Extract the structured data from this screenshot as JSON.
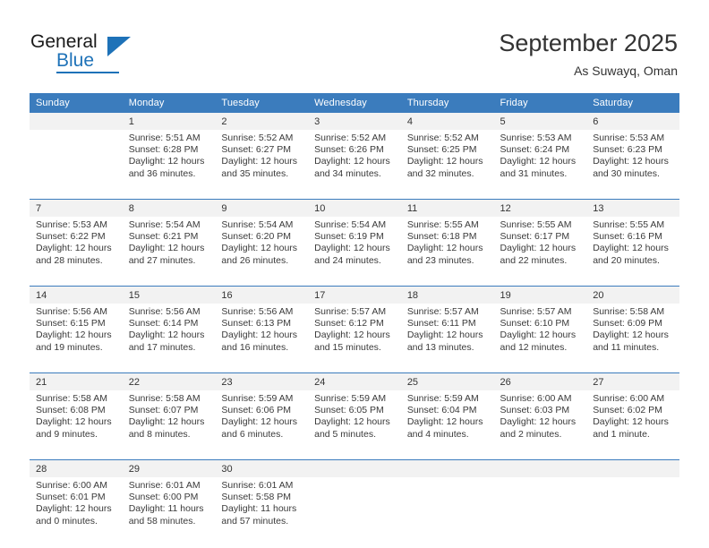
{
  "brand": {
    "name_part1": "General",
    "name_part2": "Blue",
    "accent_color": "#1e72b8"
  },
  "header": {
    "title": "September 2025",
    "subtitle": "As Suwayq, Oman"
  },
  "theme": {
    "header_row_color": "#3b7cbd",
    "day_band_color": "#f2f2f2",
    "text_color": "#333333"
  },
  "weekdays": [
    "Sunday",
    "Monday",
    "Tuesday",
    "Wednesday",
    "Thursday",
    "Friday",
    "Saturday"
  ],
  "weeks": [
    [
      {
        "day": ""
      },
      {
        "day": "1",
        "sunrise": "Sunrise: 5:51 AM",
        "sunset": "Sunset: 6:28 PM",
        "daylight1": "Daylight: 12 hours",
        "daylight2": "and 36 minutes."
      },
      {
        "day": "2",
        "sunrise": "Sunrise: 5:52 AM",
        "sunset": "Sunset: 6:27 PM",
        "daylight1": "Daylight: 12 hours",
        "daylight2": "and 35 minutes."
      },
      {
        "day": "3",
        "sunrise": "Sunrise: 5:52 AM",
        "sunset": "Sunset: 6:26 PM",
        "daylight1": "Daylight: 12 hours",
        "daylight2": "and 34 minutes."
      },
      {
        "day": "4",
        "sunrise": "Sunrise: 5:52 AM",
        "sunset": "Sunset: 6:25 PM",
        "daylight1": "Daylight: 12 hours",
        "daylight2": "and 32 minutes."
      },
      {
        "day": "5",
        "sunrise": "Sunrise: 5:53 AM",
        "sunset": "Sunset: 6:24 PM",
        "daylight1": "Daylight: 12 hours",
        "daylight2": "and 31 minutes."
      },
      {
        "day": "6",
        "sunrise": "Sunrise: 5:53 AM",
        "sunset": "Sunset: 6:23 PM",
        "daylight1": "Daylight: 12 hours",
        "daylight2": "and 30 minutes."
      }
    ],
    [
      {
        "day": "7",
        "sunrise": "Sunrise: 5:53 AM",
        "sunset": "Sunset: 6:22 PM",
        "daylight1": "Daylight: 12 hours",
        "daylight2": "and 28 minutes."
      },
      {
        "day": "8",
        "sunrise": "Sunrise: 5:54 AM",
        "sunset": "Sunset: 6:21 PM",
        "daylight1": "Daylight: 12 hours",
        "daylight2": "and 27 minutes."
      },
      {
        "day": "9",
        "sunrise": "Sunrise: 5:54 AM",
        "sunset": "Sunset: 6:20 PM",
        "daylight1": "Daylight: 12 hours",
        "daylight2": "and 26 minutes."
      },
      {
        "day": "10",
        "sunrise": "Sunrise: 5:54 AM",
        "sunset": "Sunset: 6:19 PM",
        "daylight1": "Daylight: 12 hours",
        "daylight2": "and 24 minutes."
      },
      {
        "day": "11",
        "sunrise": "Sunrise: 5:55 AM",
        "sunset": "Sunset: 6:18 PM",
        "daylight1": "Daylight: 12 hours",
        "daylight2": "and 23 minutes."
      },
      {
        "day": "12",
        "sunrise": "Sunrise: 5:55 AM",
        "sunset": "Sunset: 6:17 PM",
        "daylight1": "Daylight: 12 hours",
        "daylight2": "and 22 minutes."
      },
      {
        "day": "13",
        "sunrise": "Sunrise: 5:55 AM",
        "sunset": "Sunset: 6:16 PM",
        "daylight1": "Daylight: 12 hours",
        "daylight2": "and 20 minutes."
      }
    ],
    [
      {
        "day": "14",
        "sunrise": "Sunrise: 5:56 AM",
        "sunset": "Sunset: 6:15 PM",
        "daylight1": "Daylight: 12 hours",
        "daylight2": "and 19 minutes."
      },
      {
        "day": "15",
        "sunrise": "Sunrise: 5:56 AM",
        "sunset": "Sunset: 6:14 PM",
        "daylight1": "Daylight: 12 hours",
        "daylight2": "and 17 minutes."
      },
      {
        "day": "16",
        "sunrise": "Sunrise: 5:56 AM",
        "sunset": "Sunset: 6:13 PM",
        "daylight1": "Daylight: 12 hours",
        "daylight2": "and 16 minutes."
      },
      {
        "day": "17",
        "sunrise": "Sunrise: 5:57 AM",
        "sunset": "Sunset: 6:12 PM",
        "daylight1": "Daylight: 12 hours",
        "daylight2": "and 15 minutes."
      },
      {
        "day": "18",
        "sunrise": "Sunrise: 5:57 AM",
        "sunset": "Sunset: 6:11 PM",
        "daylight1": "Daylight: 12 hours",
        "daylight2": "and 13 minutes."
      },
      {
        "day": "19",
        "sunrise": "Sunrise: 5:57 AM",
        "sunset": "Sunset: 6:10 PM",
        "daylight1": "Daylight: 12 hours",
        "daylight2": "and 12 minutes."
      },
      {
        "day": "20",
        "sunrise": "Sunrise: 5:58 AM",
        "sunset": "Sunset: 6:09 PM",
        "daylight1": "Daylight: 12 hours",
        "daylight2": "and 11 minutes."
      }
    ],
    [
      {
        "day": "21",
        "sunrise": "Sunrise: 5:58 AM",
        "sunset": "Sunset: 6:08 PM",
        "daylight1": "Daylight: 12 hours",
        "daylight2": "and 9 minutes."
      },
      {
        "day": "22",
        "sunrise": "Sunrise: 5:58 AM",
        "sunset": "Sunset: 6:07 PM",
        "daylight1": "Daylight: 12 hours",
        "daylight2": "and 8 minutes."
      },
      {
        "day": "23",
        "sunrise": "Sunrise: 5:59 AM",
        "sunset": "Sunset: 6:06 PM",
        "daylight1": "Daylight: 12 hours",
        "daylight2": "and 6 minutes."
      },
      {
        "day": "24",
        "sunrise": "Sunrise: 5:59 AM",
        "sunset": "Sunset: 6:05 PM",
        "daylight1": "Daylight: 12 hours",
        "daylight2": "and 5 minutes."
      },
      {
        "day": "25",
        "sunrise": "Sunrise: 5:59 AM",
        "sunset": "Sunset: 6:04 PM",
        "daylight1": "Daylight: 12 hours",
        "daylight2": "and 4 minutes."
      },
      {
        "day": "26",
        "sunrise": "Sunrise: 6:00 AM",
        "sunset": "Sunset: 6:03 PM",
        "daylight1": "Daylight: 12 hours",
        "daylight2": "and 2 minutes."
      },
      {
        "day": "27",
        "sunrise": "Sunrise: 6:00 AM",
        "sunset": "Sunset: 6:02 PM",
        "daylight1": "Daylight: 12 hours",
        "daylight2": "and 1 minute."
      }
    ],
    [
      {
        "day": "28",
        "sunrise": "Sunrise: 6:00 AM",
        "sunset": "Sunset: 6:01 PM",
        "daylight1": "Daylight: 12 hours",
        "daylight2": "and 0 minutes."
      },
      {
        "day": "29",
        "sunrise": "Sunrise: 6:01 AM",
        "sunset": "Sunset: 6:00 PM",
        "daylight1": "Daylight: 11 hours",
        "daylight2": "and 58 minutes."
      },
      {
        "day": "30",
        "sunrise": "Sunrise: 6:01 AM",
        "sunset": "Sunset: 5:58 PM",
        "daylight1": "Daylight: 11 hours",
        "daylight2": "and 57 minutes."
      },
      {
        "day": ""
      },
      {
        "day": ""
      },
      {
        "day": ""
      },
      {
        "day": ""
      }
    ]
  ]
}
